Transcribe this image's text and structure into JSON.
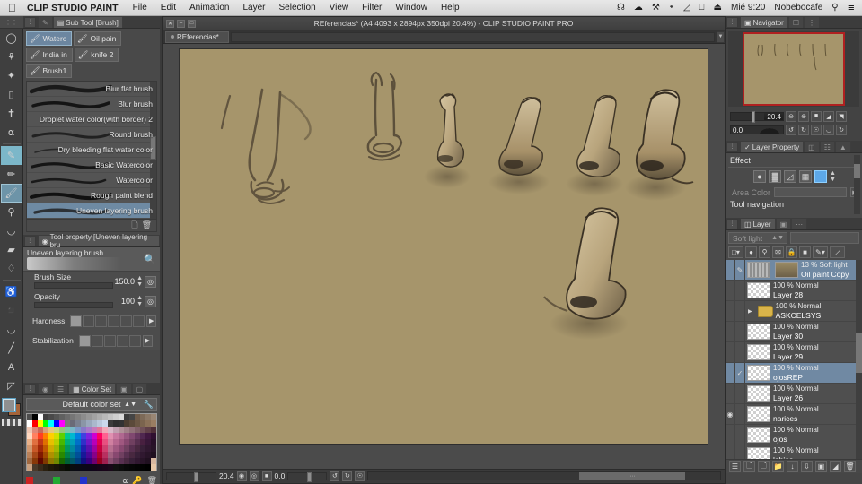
{
  "macbar": {
    "apple_icon": "apple-icon",
    "app_name": "CLIP STUDIO PAINT",
    "menus": [
      "File",
      "Edit",
      "Animation",
      "Layer",
      "Selection",
      "View",
      "Filter",
      "Window",
      "Help"
    ],
    "status_icons": [
      "airplay-icon",
      "cloud-icon",
      "app-icon",
      "bluetooth-icon",
      "wifi-icon",
      "display-icon",
      "eject-icon"
    ],
    "time": "Mié 9:20",
    "user": "Nobebocafe",
    "search_icon": "search-icon",
    "list_icon": "control-center-icon"
  },
  "toolbar": {
    "tools": [
      {
        "name": "lasso-tool",
        "glyph": "◯"
      },
      {
        "name": "magic-wand-tool",
        "glyph": "🝑"
      },
      {
        "name": "auto-select-tool",
        "glyph": "✦"
      },
      {
        "name": "marquee-tool",
        "glyph": "▭"
      },
      {
        "name": "operation-tool",
        "glyph": "✥"
      },
      {
        "name": "eyedropper-tool",
        "glyph": "⌇"
      },
      {
        "name": "pen-tool",
        "glyph": "✒"
      },
      {
        "name": "pencil-tool",
        "glyph": "✏"
      },
      {
        "name": "brush-tool",
        "glyph": "🖌"
      },
      {
        "name": "airbrush-tool",
        "glyph": "⚱"
      },
      {
        "name": "decoration-tool",
        "glyph": "◠"
      },
      {
        "name": "eraser-tool",
        "glyph": "▱"
      },
      {
        "name": "blend-tool",
        "glyph": "💧"
      },
      {
        "name": "fill-tool",
        "glyph": "🪣"
      },
      {
        "name": "gradient-tool",
        "glyph": "◨"
      },
      {
        "name": "figure-tool",
        "glyph": "◜"
      },
      {
        "name": "line-tool",
        "glyph": "╱"
      },
      {
        "name": "text-tool",
        "glyph": "A"
      },
      {
        "name": "correct-line-tool",
        "glyph": "⊿"
      }
    ],
    "selected_index": 8,
    "foreground_color": "#8f8f8f",
    "background_color": "#a5643a"
  },
  "subtool": {
    "panel_title": "Sub Tool [Brush]",
    "tool_icon": "subtool-icon",
    "grip_icon": "grip-icon",
    "chips": [
      {
        "label": "Waterc",
        "icon": "watercolor-icon",
        "active": true
      },
      {
        "label": "Oil pain",
        "icon": "oilpaint-icon",
        "active": false
      },
      {
        "label": "India in",
        "icon": "indiaink-icon",
        "active": false
      },
      {
        "label": "knife 2",
        "icon": "knife-icon",
        "active": false
      },
      {
        "label": "Brush1",
        "icon": "brush-icon",
        "active": false
      }
    ],
    "brushes": [
      {
        "label": "Blur flat brush",
        "active": false
      },
      {
        "label": "Blur brush",
        "active": false
      },
      {
        "label": "Droplet water color(with border) 2",
        "active": false
      },
      {
        "label": "Round brush",
        "active": false
      },
      {
        "label": "Dry bleeding flat water color",
        "active": false
      },
      {
        "label": "Basic Watercolor",
        "active": false
      },
      {
        "label": "Watercolor",
        "active": false
      },
      {
        "label": "Rough paint blend",
        "active": false
      },
      {
        "label": "Uneven layering brush",
        "active": true
      }
    ],
    "footer_icons": [
      "new-subtool-icon",
      "delete-subtool-icon"
    ]
  },
  "toolproperty": {
    "panel_title": "Tool property [Uneven layering bru",
    "preview_label": "Uneven layering brush",
    "magnifier_icon": "magnifier-icon",
    "rows": [
      {
        "label": "Brush Size",
        "value": "150.0",
        "fill": 78,
        "has_spin": true,
        "has_round": true
      },
      {
        "label": "Opacity",
        "value": "100",
        "fill": 100,
        "has_spin": true,
        "has_round": true
      }
    ],
    "hardness": {
      "label": "Hardness",
      "boxes": 6,
      "selected": 0
    },
    "stabilization": {
      "label": "Stabilization",
      "boxes": 5,
      "selected": 0
    }
  },
  "colorset": {
    "panel_title": "Color Set",
    "tabs": [
      "color-wheel-icon",
      "color-slider-icon",
      "color-set-icon",
      "intermediate-color-icon",
      "approx-color-icon"
    ],
    "selected_set": "Default color set",
    "dropdown_icon": "chevron-updown-icon",
    "wrench_icon": "wrench-icon",
    "swatch_red": "#cc2222",
    "swatch_green": "#22aa33",
    "swatch_blue": "#2233cc",
    "footer_icons": [
      "eyedropper-icon",
      "key-icon",
      "trash-icon"
    ],
    "palette": [
      [
        "#4d4d4d",
        "#000000",
        "#ffffff",
        "#3f3f3f",
        "#4a4a4a",
        "#555555",
        "#606060",
        "#6b6b6b",
        "#767676",
        "#818181",
        "#8c8c8c",
        "#979797",
        "#a2a2a2",
        "#adadad",
        "#b8b8b8",
        "#c3c3c3",
        "#cecece",
        "#d9d9d9",
        "#3a3a3a",
        "#454545",
        "#6e5b4a",
        "#7d6a58",
        "#8b7866",
        "#998674"
      ],
      [
        "#ffffff",
        "#ff0000",
        "#ffff00",
        "#00ff00",
        "#00ffff",
        "#0000ff",
        "#ff00ff",
        "#7a7a7a",
        "#6a6a78",
        "#7a8090",
        "#8a96a6",
        "#9aa8bc",
        "#aab8cc",
        "#bac8dc",
        "#cad8ec",
        "#3c3c3c",
        "#2f2f2f",
        "#333333",
        "#4b3d30",
        "#5b4a3a",
        "#6b5744",
        "#7b644e",
        "#8b7158",
        "#9b7e62"
      ],
      [
        "#f0c8b4",
        "#e08878",
        "#c86858",
        "#d8a078",
        "#e8c878",
        "#c8d878",
        "#98c878",
        "#78c8a8",
        "#78b8c8",
        "#7898c8",
        "#8878c8",
        "#a878c8",
        "#c878b8",
        "#e07898",
        "#f0a8b8",
        "#d8b8c8",
        "#c0a0b0",
        "#b09098",
        "#a08088",
        "#907078",
        "#806068",
        "#705058",
        "#604048",
        "#503038"
      ],
      [
        "#ffd8c0",
        "#ff8060",
        "#ff4020",
        "#ff8000",
        "#ffd000",
        "#d0e000",
        "#60d000",
        "#00c890",
        "#00b8d0",
        "#0080e0",
        "#4040e0",
        "#8020e0",
        "#d000d0",
        "#ff0060",
        "#ff6090",
        "#e090b0",
        "#c878a0",
        "#b06890",
        "#985880",
        "#804870",
        "#683860",
        "#502850",
        "#401840",
        "#301030"
      ],
      [
        "#e8b088",
        "#e07040",
        "#c03818",
        "#e07000",
        "#e8c000",
        "#b8d000",
        "#48b800",
        "#00b078",
        "#00a0b8",
        "#0070c8",
        "#3030c8",
        "#7018c8",
        "#b800b8",
        "#e00050",
        "#e85080",
        "#d080a0",
        "#b86890",
        "#a05880",
        "#884870",
        "#704060",
        "#583050",
        "#482040",
        "#381838",
        "#281028"
      ],
      [
        "#d09870",
        "#c85828",
        "#a02808",
        "#c05800",
        "#d0a800",
        "#a0b800",
        "#38a000",
        "#009860",
        "#0088a0",
        "#0060b0",
        "#2020b0",
        "#5810b0",
        "#a000a0",
        "#c80040",
        "#d04070",
        "#b87090",
        "#a05880",
        "#884870",
        "#704060",
        "#583050",
        "#482840",
        "#382038",
        "#301830",
        "#281428"
      ],
      [
        "#b88058",
        "#a84818",
        "#801800",
        "#a04800",
        "#b09000",
        "#88a000",
        "#288800",
        "#008048",
        "#007088",
        "#005098",
        "#181898",
        "#480898",
        "#880088",
        "#b00030",
        "#b83060",
        "#a06080",
        "#884870",
        "#704060",
        "#583050",
        "#482840",
        "#382038",
        "#301830",
        "#281428",
        "#201020"
      ],
      [
        "#a06840",
        "#883808",
        "#600800",
        "#803800",
        "#907800",
        "#708800",
        "#186800",
        "#006038",
        "#005868",
        "#004080",
        "#101080",
        "#380080",
        "#700070",
        "#980020",
        "#a02050",
        "#885070",
        "#704060",
        "#583050",
        "#482840",
        "#382038",
        "#301830",
        "#281428",
        "#201020",
        "#d8b8a0"
      ],
      [
        "#c8a080",
        "#4a3a2a",
        "#3a2a1a",
        "#2a2010",
        "#201808",
        "#181408",
        "#101008",
        "#080c04",
        "#0a0c10",
        "#0a0a14",
        "#0a0818",
        "#0c0618",
        "#100418",
        "#140418",
        "#180418",
        "#180818",
        "#101010",
        "#0c0c0c",
        "#080808",
        "#060606",
        "#040404",
        "#020202",
        "#000000",
        "#e8c8a8"
      ]
    ]
  },
  "canvas": {
    "window_buttons": [
      "close-button",
      "minimize-button",
      "maximize-button"
    ],
    "title": "REferencias* (A4 4093 x 2894px 350dpi 20.4%)  - CLIP STUDIO PAINT PRO",
    "tab_label": "REferencias*",
    "paper_color": "#a6956b",
    "status": {
      "zoom": "20.4",
      "rotation": "0.0",
      "icons": [
        "zoom-slider",
        "zoom-in-icon",
        "rotate-icon",
        "fit-icon",
        "rotate-left-icon",
        "rotate-right-icon",
        "reset-icon"
      ]
    }
  },
  "navigator": {
    "panel_title": "Navigator",
    "tabs": [
      "navigator-icon",
      "subview-icon",
      "item-bank-icon"
    ],
    "zoom": "20.4",
    "rotation": "0.0",
    "buttons": [
      "zoom-out-icon",
      "zoom-in-icon",
      "fit-icon",
      "flip-horizontal-icon",
      "flip-vertical-icon",
      "rotate-left-icon",
      "rotate-right-icon",
      "reset-rotation-icon",
      "mirror-icon",
      "rotate-icon"
    ]
  },
  "layerproperty": {
    "panel_title": "Layer Property",
    "tabs": [
      "layer-property-icon",
      "animation-cels-icon",
      "timeline-icon",
      "sub-view-icon"
    ],
    "effect_label": "Effect",
    "effect_buttons": [
      "border-effect-icon",
      "tone-effect-icon",
      "gradient-effect-icon",
      "halftone-icon",
      "layer-color-icon"
    ],
    "area_color_label": "Area Color",
    "tool_navigation_label": "Tool navigation"
  },
  "layers": {
    "panel_title": "Layer",
    "tabs": [
      "layer-icon",
      "animation-icon",
      "quick-access-icon"
    ],
    "blend_mode": "Soft light",
    "control_icons": [
      "palette-color-icon",
      "clip-below-icon",
      "mask-icon",
      "ruler-icon",
      "lock-icon",
      "lock-transparency-icon",
      "draft-icon",
      "layer-select-icon"
    ],
    "items": [
      {
        "opacity": "13 % Soft light",
        "name": "Oil paint Copy",
        "selected": true,
        "visible": true,
        "checked": false,
        "folder": false,
        "thumb": "art"
      },
      {
        "opacity": "100 % Normal",
        "name": "Layer 28",
        "selected": false,
        "visible": false,
        "checked": false,
        "folder": false,
        "thumb": "sketch"
      },
      {
        "opacity": "100 % Normal",
        "name": "ASKCELSYS",
        "selected": false,
        "visible": false,
        "checked": false,
        "folder": true,
        "thumb": "folder"
      },
      {
        "opacity": "100 % Normal",
        "name": "Layer 30",
        "selected": false,
        "visible": false,
        "checked": false,
        "folder": false,
        "thumb": "empty"
      },
      {
        "opacity": "100 % Normal",
        "name": "Layer 29",
        "selected": false,
        "visible": false,
        "checked": false,
        "folder": false,
        "thumb": "faint"
      },
      {
        "opacity": "100 % Normal",
        "name": "ojosREP",
        "selected": true,
        "visible": false,
        "checked": true,
        "folder": false,
        "thumb": "empty"
      },
      {
        "opacity": "100 % Normal",
        "name": "Layer 26",
        "selected": false,
        "visible": false,
        "checked": false,
        "folder": false,
        "thumb": "empty"
      },
      {
        "opacity": "100 % Normal",
        "name": "narices",
        "selected": false,
        "visible": true,
        "checked": false,
        "folder": false,
        "thumb": "empty"
      },
      {
        "opacity": "100 % Normal",
        "name": "ojos",
        "selected": false,
        "visible": false,
        "checked": false,
        "folder": false,
        "thumb": "empty"
      },
      {
        "opacity": "100 % Normal",
        "name": "labios",
        "selected": false,
        "visible": false,
        "checked": false,
        "folder": false,
        "thumb": "empty"
      }
    ],
    "footer_icons": [
      "layer-list-icon",
      "new-raster-layer-icon",
      "new-vector-layer-icon",
      "new-folder-icon",
      "transfer-down-icon",
      "combine-down-icon",
      "mask-icon",
      "clip-icon",
      "delete-layer-icon"
    ]
  }
}
